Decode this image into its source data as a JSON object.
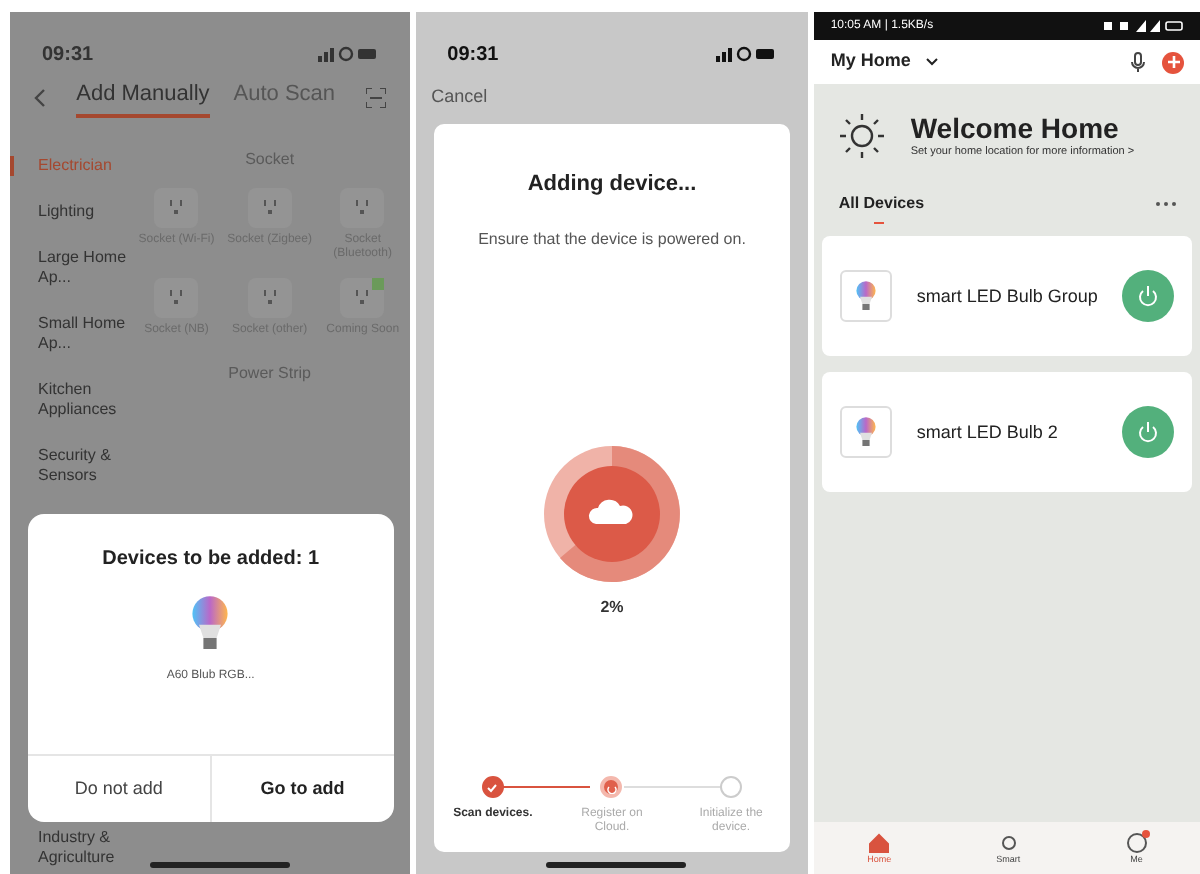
{
  "screen_1": {
    "status_bar": {
      "time": "09:31"
    },
    "tabs": [
      {
        "label": "Add Manually",
        "selected": true
      },
      {
        "label": "Auto Scan",
        "selected": false
      }
    ],
    "sidebar": {
      "items": [
        {
          "label": "Electrician",
          "selected": true
        },
        {
          "label": "Lighting",
          "selected": false
        },
        {
          "label": "Large Home Ap...",
          "selected": false
        },
        {
          "label": "Small Home Ap...",
          "selected": false
        },
        {
          "label": "Kitchen Appliances",
          "selected": false
        },
        {
          "label": "Security & Sensors",
          "selected": false
        },
        {
          "label": "Industry & Agriculture",
          "selected": false
        }
      ]
    },
    "sections": [
      {
        "title": "Socket",
        "items": [
          {
            "label": "Socket (Wi-Fi)",
            "checked": false
          },
          {
            "label": "Socket (Zigbee)",
            "checked": false
          },
          {
            "label": "Socket (Bluetooth)",
            "checked": false
          },
          {
            "label": "Socket (NB)",
            "checked": false
          },
          {
            "label": "Socket (other)",
            "checked": false
          },
          {
            "label": "Coming Soon",
            "checked": true
          }
        ]
      },
      {
        "title": "Power Strip"
      }
    ],
    "dialog": {
      "title": "Devices to be added: 1",
      "device": "A60 Blub RGB...",
      "buttons": [
        "Do not add",
        "Go to add"
      ]
    }
  },
  "screen_2": {
    "status_bar": {
      "time": "09:31"
    },
    "cancel": "Cancel",
    "title": "Adding device...",
    "subtitle": "Ensure that the device is powered on.",
    "percent": "2%",
    "steps": [
      {
        "label": "Scan devices.",
        "done": true,
        "active": false
      },
      {
        "label": "Register on Cloud.",
        "done": false,
        "active": true
      },
      {
        "label": "Initialize the device.",
        "done": false,
        "active": false
      }
    ]
  },
  "screen_3": {
    "status_bar": {
      "text": "10:05 AM | 1.5KB/s"
    },
    "home": "My Home",
    "welcome": {
      "title": "Welcome Home",
      "subtitle": "Set your home location for more information >"
    },
    "section": "All Devices",
    "devices": [
      {
        "name": "smart LED Bulb Group",
        "on": true
      },
      {
        "name": "smart LED Bulb 2",
        "on": true
      }
    ],
    "nav": [
      {
        "label": "Home",
        "selected": true
      },
      {
        "label": "Smart",
        "selected": false
      },
      {
        "label": "Me",
        "selected": false,
        "badge": true
      }
    ]
  }
}
